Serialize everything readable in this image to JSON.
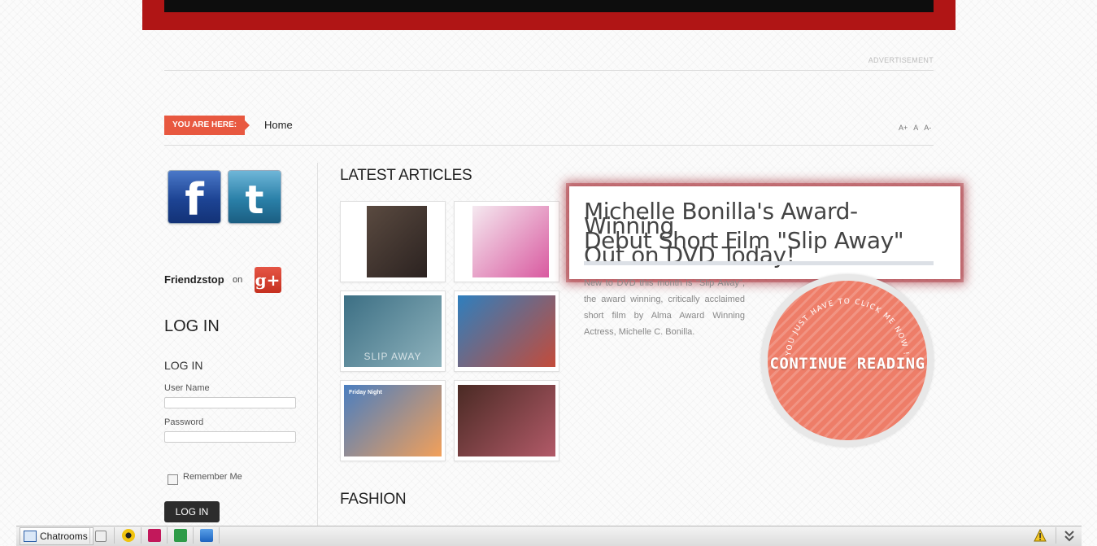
{
  "header": {
    "advertisement_label": "ADVERTISEMENT"
  },
  "breadcrumb": {
    "you_are_here": "YOU ARE HERE:",
    "home": "Home",
    "font_increase": "A+",
    "font_reset": "A",
    "font_decrease": "A-"
  },
  "sidebar": {
    "facebook_letter": "f",
    "twitter_letter": "t",
    "friendzstop": "Friendzstop",
    "on": "on",
    "gplus": "g+",
    "login_heading": "LOG IN",
    "login_subheading": "LOG IN",
    "username_label": "User Name",
    "username_value": "",
    "password_label": "Password",
    "password_value": "",
    "remember_me": "Remember Me",
    "remember_checked": false,
    "login_button": "LOG IN"
  },
  "main": {
    "latest_articles": "LATEST ARTICLES",
    "fashion": "FASHION",
    "thumbnails": [
      {
        "name": "thumb-band-photo",
        "colors": [
          "#5a4a40",
          "#2b2220"
        ]
      },
      {
        "name": "thumb-dinah-flyer",
        "colors": [
          "#f5e9f0",
          "#d95aa0"
        ]
      },
      {
        "name": "thumb-slip-away",
        "colors": [
          "#3c6f84",
          "#8fb3bd"
        ]
      },
      {
        "name": "thumb-pool-party",
        "colors": [
          "#2e7fbe",
          "#c44b3a"
        ]
      },
      {
        "name": "thumb-friday-night-flyer",
        "colors": [
          "#4a7ec0",
          "#f2a05a"
        ]
      },
      {
        "name": "thumb-portrait",
        "colors": [
          "#4a2a24",
          "#b25a68"
        ]
      }
    ],
    "slip_away_caption": "SLIP AWAY",
    "friday_night_caption": "Friday Night",
    "featured": {
      "title_line1": "Michelle Bonilla's Award-Winning",
      "title_line2": "Debut Short Film \"Slip Away\"",
      "title_line3": "Out on DVD Today!",
      "excerpt": "New to DVD this month is \"Slip Away\", the award winning, critically acclaimed short film by Alma Award Winning Actress, Michelle C. Bonilla.",
      "arc_text": "YOU JUST HAVE TO CLICK ME NOW !",
      "continue_reading": "CONTINUE READING"
    }
  },
  "taskbar": {
    "chatrooms": "Chatrooms"
  },
  "colors": {
    "header_red": "#b01515",
    "accent_orange": "#e85840",
    "continue_coral": "#ee7d68",
    "popup_glow": "#9a1420"
  }
}
